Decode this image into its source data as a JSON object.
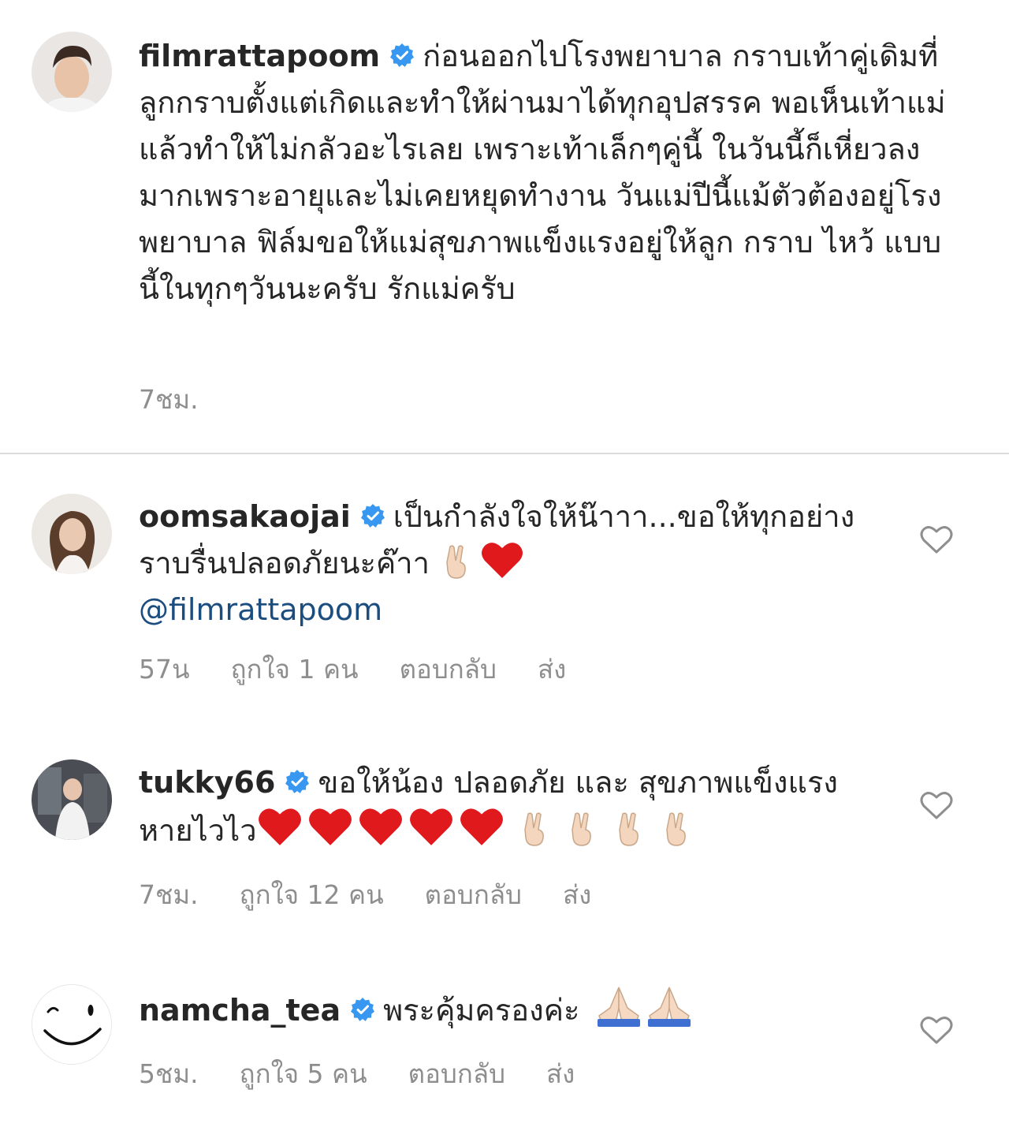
{
  "caption": {
    "username": "filmrattapoom",
    "verified": true,
    "text": "ก่อนออกไปโรงพยาบาล กราบเท้าคู่เดิมที่ลูกกราบตั้งแต่เกิดและทำให้ผ่านมาได้ทุกอุปสรรค พอเห็นเท้าแม่แล้วทำให้ไม่กลัวอะไรเลย เพราะเท้าเล็กๆคู่นี้ ในวันนี้ก็เหี่ยวลงมากเพราะอายุและไม่เคยหยุดทำงาน วันแม่ปีนี้แม้ตัวต้องอยู่โรงพยาบาล ฟิล์มขอให้แม่สุขภาพแข็งแรงอยู่ให้ลูก กราบ ไหว้ แบบนี้ในทุกๆวันนะครับ รักแม่ครับ",
    "time": "7ชม."
  },
  "comments": [
    {
      "username": "oomsakaojai",
      "verified": true,
      "text": "เป็นกำลังใจให้น๊าาา...ขอให้ทุกอย่างราบรื่นปลอดภัยนะค๊าา",
      "emojis": [
        "victory-hand",
        "red-heart"
      ],
      "mention": "@filmrattapoom",
      "time": "57น",
      "likes": "ถูกใจ 1 คน",
      "reply": "ตอบกลับ",
      "send": "ส่ง"
    },
    {
      "username": "tukky66",
      "verified": true,
      "text": "ขอให้น้อง ปลอดภัย และ สุขภาพแข็งแรง หายไวไว",
      "emojis": [
        "red-heart",
        "red-heart",
        "red-heart",
        "red-heart",
        "red-heart",
        "victory-hand",
        "victory-hand",
        "victory-hand",
        "victory-hand"
      ],
      "time": "7ชม.",
      "likes": "ถูกใจ 12 คน",
      "reply": "ตอบกลับ",
      "send": "ส่ง"
    },
    {
      "username": "namcha_tea",
      "verified": true,
      "text": "พระคุ้มครองค่ะ",
      "emojis": [
        "folded-hands",
        "folded-hands"
      ],
      "time": "5ชม.",
      "likes": "ถูกใจ 5 คน",
      "reply": "ตอบกลับ",
      "send": "ส่ง"
    }
  ],
  "colors": {
    "text": "#262626",
    "meta": "#8e8e8e",
    "verified": "#3897f0",
    "mention": "#1c4d7f",
    "divider": "#dbdbdb"
  }
}
